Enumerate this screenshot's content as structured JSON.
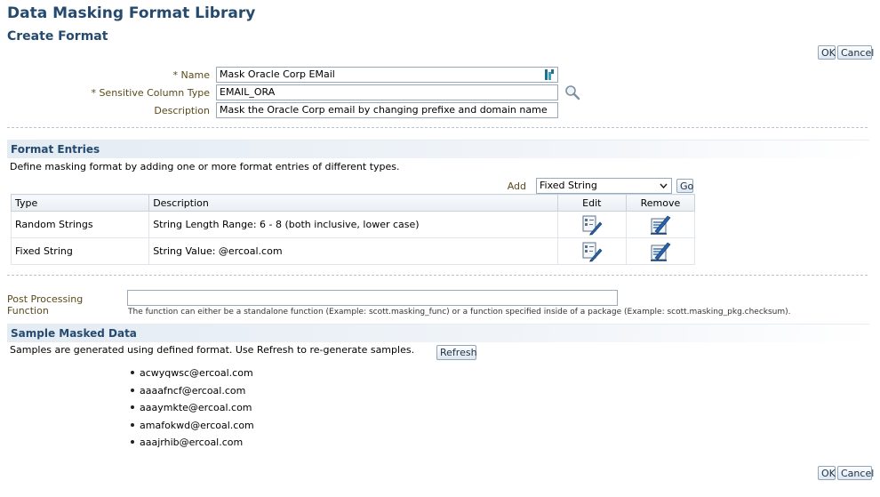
{
  "header": {
    "title": "Data Masking Format Library",
    "subtitle": "Create Format"
  },
  "actions": {
    "ok_label": "OK",
    "cancel_label": "Cancel"
  },
  "form": {
    "required_marker": "*",
    "name_label": "Name",
    "name_value": "Mask Oracle Corp EMail",
    "sensitive_label": "Sensitive Column Type",
    "sensitive_value": "EMAIL_ORA",
    "description_label": "Description",
    "description_value": "Mask the Oracle Corp email by changing prefixe and domain name"
  },
  "format_entries": {
    "title": "Format Entries",
    "instructions": "Define masking format by adding one or more format entries of different types.",
    "add_label": "Add",
    "add_selected": "Fixed String",
    "go_label": "Go",
    "columns": [
      "Type",
      "Description",
      "Edit",
      "Remove"
    ],
    "rows": [
      {
        "type": "Random Strings",
        "description": "String Length Range: 6 - 8 (both inclusive, lower case)"
      },
      {
        "type": "Fixed String",
        "description": "String Value: @ercoal.com"
      }
    ]
  },
  "post_processing": {
    "label": "Post Processing Function",
    "value": "",
    "hint": "The function can either be a standalone function (Example: scott.masking_func) or a function specified inside of a package (Example: scott.masking_pkg.checksum)."
  },
  "sample": {
    "title": "Sample Masked Data",
    "instructions": "Samples are generated using defined format. Use Refresh to re-generate samples.",
    "refresh_label": "Refresh",
    "items": [
      "acwyqwsc@ercoal.com",
      "aaaafncf@ercoal.com",
      "aaaymkte@ercoal.com",
      "amafokwd@ercoal.com",
      "aaajrhib@ercoal.com"
    ]
  },
  "icons": {
    "name_field": "translate-icon",
    "sensitive_field": "search-icon",
    "edit": "edit-pencil-icon",
    "remove": "remove-pencil-icon"
  },
  "colors": {
    "title": "#254a6e",
    "label": "#5a4a1a",
    "section_bg": "#e3ebf3"
  }
}
